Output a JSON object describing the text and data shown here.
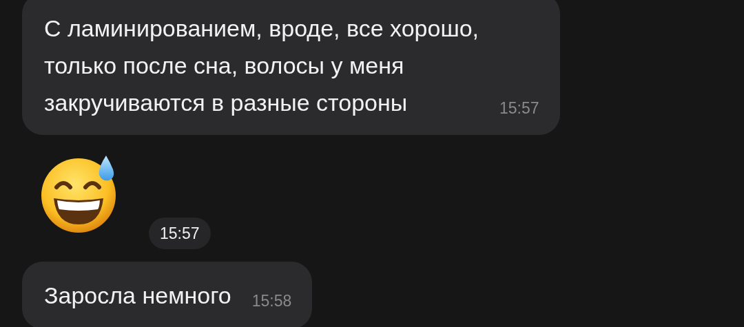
{
  "messages": [
    {
      "kind": "text",
      "text": "С ламинированием, вроде, все хорошо,\nтолько после сна, волосы у меня\nзакручиваются в разные стороны",
      "time": "15:57"
    },
    {
      "kind": "emoji",
      "time": "15:57"
    },
    {
      "kind": "text",
      "text": "Заросла немного",
      "time": "15:58"
    }
  ]
}
